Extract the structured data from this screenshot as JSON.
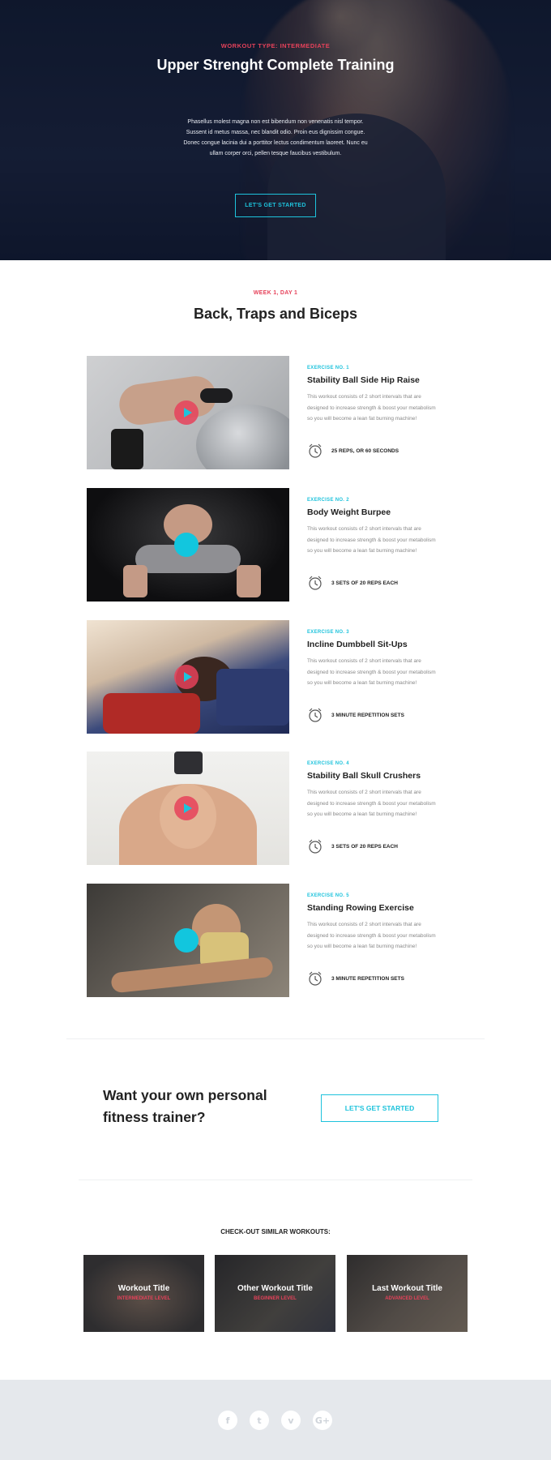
{
  "hero": {
    "tag": "WORKOUT TYPE: INTERMEDIATE",
    "title": "Upper Strenght Complete Training",
    "text": "Phasellus molest magna non est bibendum non venenatis nisl tempor. Sussent id metus massa, nec blandit odio. Proin eus dignissim congue. Donec congue lacinia dui a porttitor lectus condimentum laoreet. Nunc eu ullam corper orci, pellen tesque faucibus vestibulum.",
    "button": "LET'S GET STARTED"
  },
  "section": {
    "tag": "WEEK 1, DAY 1",
    "title": "Back, Traps and Biceps"
  },
  "exercises": [
    {
      "num": "EXERCISE NO. 1",
      "title": "Stability Ball Side Hip Raise",
      "desc": "This workout consists of 2 short intervals that are designed to increase strength & boost your metabolism so you will become a lean fat burning machine!",
      "meta": "25 REPS, OR 60 SECONDS",
      "icon": "alarm-clock-icon"
    },
    {
      "num": "EXERCISE NO. 2",
      "title": "Body Weight Burpee",
      "desc": "This workout consists of 2 short intervals that are designed to increase strength & boost your metabolism so you will become a lean fat burning machine!",
      "meta": "3 SETS OF 20 REPS EACH",
      "icon": "alarm-clock-icon"
    },
    {
      "num": "EXERCISE NO. 3",
      "title": "Incline Dumbbell Sit-Ups",
      "desc": "This workout consists of 2 short intervals that are designed to increase strength & boost your metabolism so you will become a lean fat burning machine!",
      "meta": "3 MINUTE REPETITION SETS",
      "icon": "alarm-clock-icon"
    },
    {
      "num": "EXERCISE NO. 4",
      "title": "Stability Ball Skull Crushers",
      "desc": "This workout consists of 2 short intervals that are designed to increase strength & boost your metabolism so you will become a lean fat burning machine!",
      "meta": "3 SETS OF 20 REPS EACH",
      "icon": "alarm-clock-icon"
    },
    {
      "num": "EXERCISE NO. 5",
      "title": "Standing Rowing Exercise",
      "desc": "This workout consists of 2 short intervals that are designed to increase strength & boost your metabolism so you will become a lean fat burning machine!",
      "meta": "3 MINUTE REPETITION SETS",
      "icon": "alarm-clock-icon"
    }
  ],
  "cta": {
    "text": "Want your own personal fitness trainer?",
    "button": "LET'S GET STARTED"
  },
  "similar": {
    "title": "CHECK-OUT SIMILAR WORKOUTS:",
    "cards": [
      {
        "title": "Workout Title",
        "level": "INTERMEDIATE LEVEL"
      },
      {
        "title": "Other Workout Title",
        "level": "BEGINNER LEVEL"
      },
      {
        "title": "Last Workout Title",
        "level": "ADVANCED LEVEL"
      }
    ]
  },
  "footer": {
    "social": [
      "facebook-icon",
      "twitter-icon",
      "vimeo-icon",
      "google-plus-icon"
    ]
  },
  "colors": {
    "accent_red": "#e6425a",
    "accent_cyan": "#1ec3dc",
    "footer_bg": "#e5e8ec"
  }
}
